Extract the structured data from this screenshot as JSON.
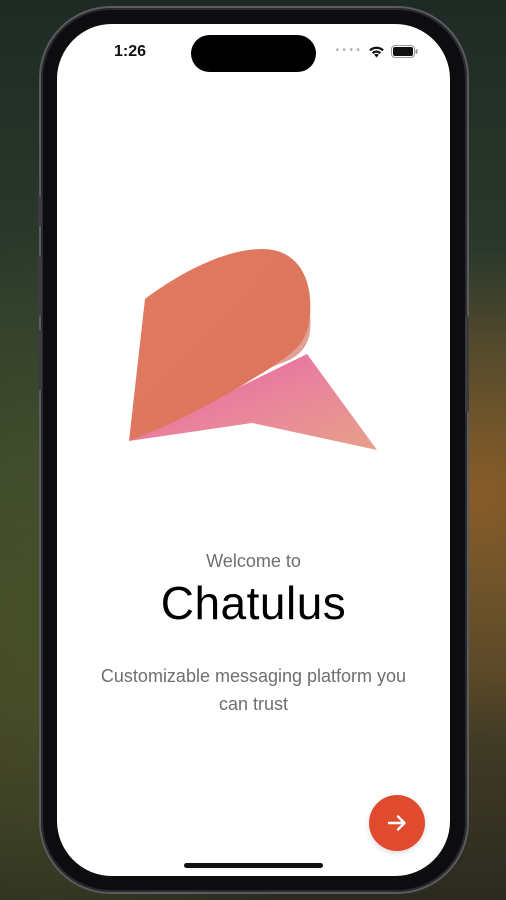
{
  "status_bar": {
    "time": "1:26",
    "signal": "signal-dots-icon",
    "wifi": "wifi-icon",
    "battery": "battery-icon"
  },
  "onboarding": {
    "logo": "chatulus-logo",
    "welcome": "Welcome to",
    "app_name": "Chatulus",
    "tagline": "Customizable messaging platform you can trust",
    "next_button": "arrow-right-icon"
  },
  "colors": {
    "accent": "#e04a2f",
    "logo_primary": "#de7a62",
    "logo_secondary": "#e989a0",
    "text_muted": "#6e6e73",
    "text_primary": "#000000"
  }
}
